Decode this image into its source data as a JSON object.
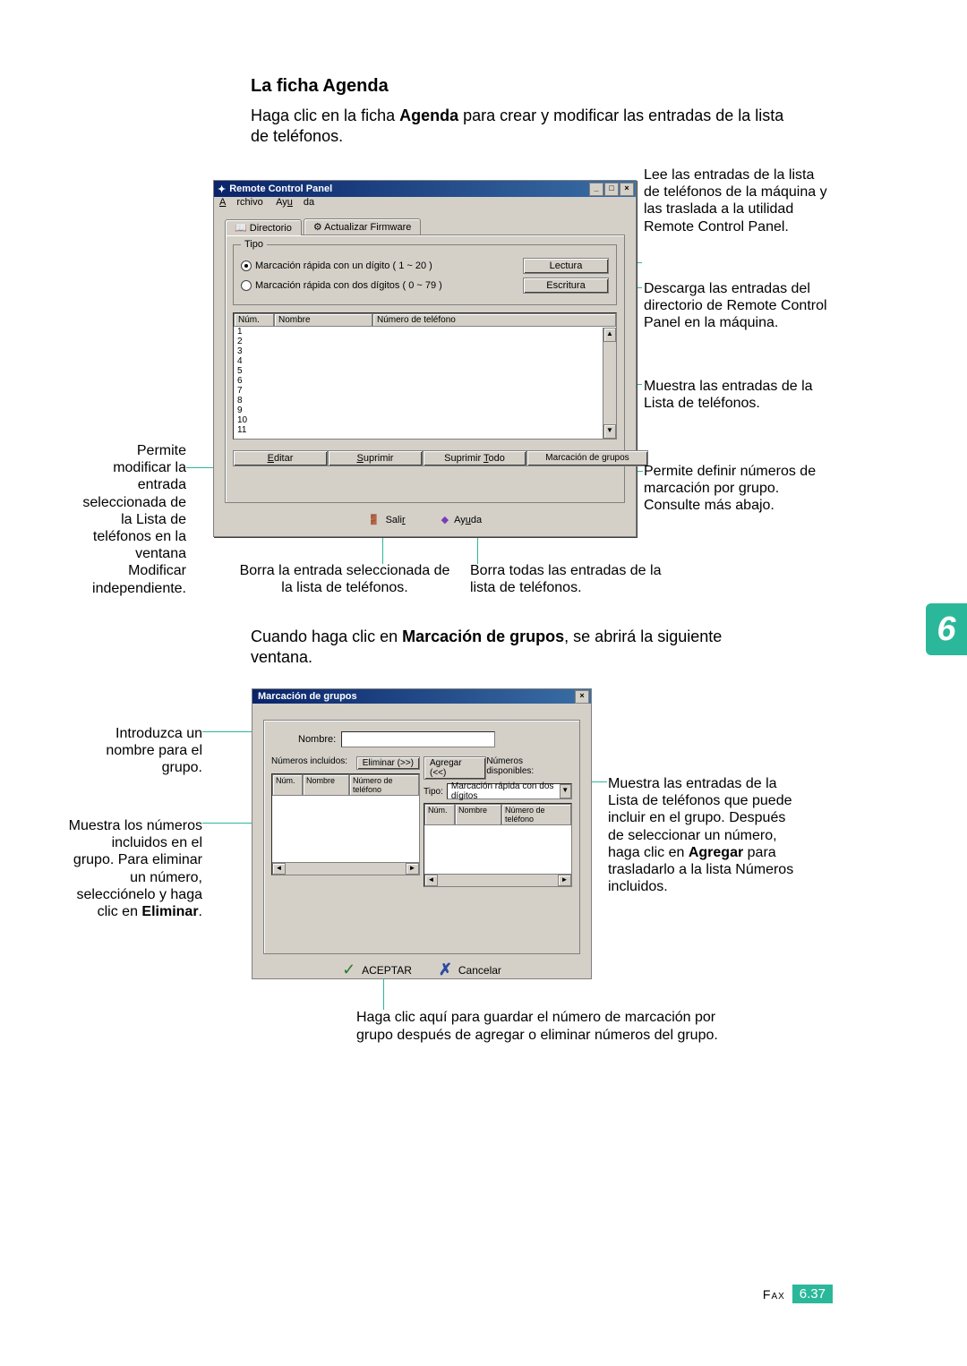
{
  "heading": "La ficha Agenda",
  "intro_pre": "Haga clic en la ficha ",
  "intro_bold": "Agenda",
  "intro_post": " para crear y modificar las entradas de la lista de teléfonos.",
  "app1": {
    "title": "Remote Control Panel",
    "menu_archivo": "Archivo",
    "menu_ayuda": "Ayuda",
    "tab_directorio": "Directorio",
    "tab_firmware": "Actualizar Firmware",
    "tipo_label": "Tipo",
    "radio1": "Marcación rápida con un dígito ( 1 ~ 20 )",
    "radio2": "Marcación rápida con dos dígitos ( 0 ~ 79 )",
    "btn_lectura": "Lectura",
    "btn_escritura": "Escritura",
    "th_num": "Núm.",
    "th_nombre": "Nombre",
    "th_tel": "Número de teléfono",
    "rows": [
      "1",
      "2",
      "3",
      "4",
      "5",
      "6",
      "7",
      "8",
      "9",
      "10",
      "11"
    ],
    "btn_editar": "Editar",
    "btn_suprimir": "Suprimir",
    "btn_suprimir_todo": "Suprimir Todo",
    "btn_grupo": "Marcación de grupos",
    "btn_salir": "Salir",
    "btn_ayuda": "Ayuda"
  },
  "callouts1": {
    "left_editar": "Permite modificar la entrada seleccionada de la Lista de teléfonos en la ventana Modificar independiente.",
    "bottom_suprimir": "Borra la entrada seleccionada de la lista de teléfonos.",
    "bottom_suprimir_todo": "Borra todas las entradas de la lista de teléfonos.",
    "right_lectura": "Lee las entradas de la lista de teléfonos de la máquina y las traslada a la utilidad Remote Control Panel.",
    "right_escritura": "Descarga las entradas del directorio de Remote Control Panel en la máquina.",
    "right_lista": "Muestra las entradas de la Lista de teléfonos.",
    "right_grupo": "Permite definir números de marcación por grupo. Consulte más abajo."
  },
  "mid_pre": "Cuando haga clic en ",
  "mid_bold": "Marcación de grupos",
  "mid_post": ", se abrirá la siguiente ventana.",
  "chapter": "6",
  "app2": {
    "title": "Marcación de grupos",
    "nombre_label": "Nombre:",
    "incluidos_label": "Números incluidos:",
    "disponibles_label": "Números disponibles:",
    "btn_eliminar": "Eliminar (>>)",
    "btn_agregar": "Agregar (<<)",
    "th_num": "Núm.",
    "th_nombre": "Nombre",
    "th_tel": "Número de teléfono",
    "tipo_label": "Tipo:",
    "tipo_value": "Marcación rápida con dos dígitos",
    "btn_aceptar": "ACEPTAR",
    "btn_cancelar": "Cancelar"
  },
  "callouts2": {
    "left_nombre": "Introduzca un nombre para el grupo.",
    "left_incluidos_pre": "Muestra los números incluidos en el grupo. Para eliminar un número, selecciónelo y haga clic en ",
    "left_incluidos_bold": "Eliminar",
    "left_incluidos_post": ".",
    "right_disp_pre": "Muestra las entradas de la Lista de teléfonos que puede incluir en el grupo. Después de seleccionar un número, haga clic en ",
    "right_disp_bold": "Agregar",
    "right_disp_post": " para trasladarlo a la lista Números incluidos.",
    "bottom_aceptar": "Haga clic aquí para guardar el número de marcación por grupo después de agregar o eliminar números del grupo."
  },
  "footer_label": "Fax",
  "footer_page": "6.37"
}
